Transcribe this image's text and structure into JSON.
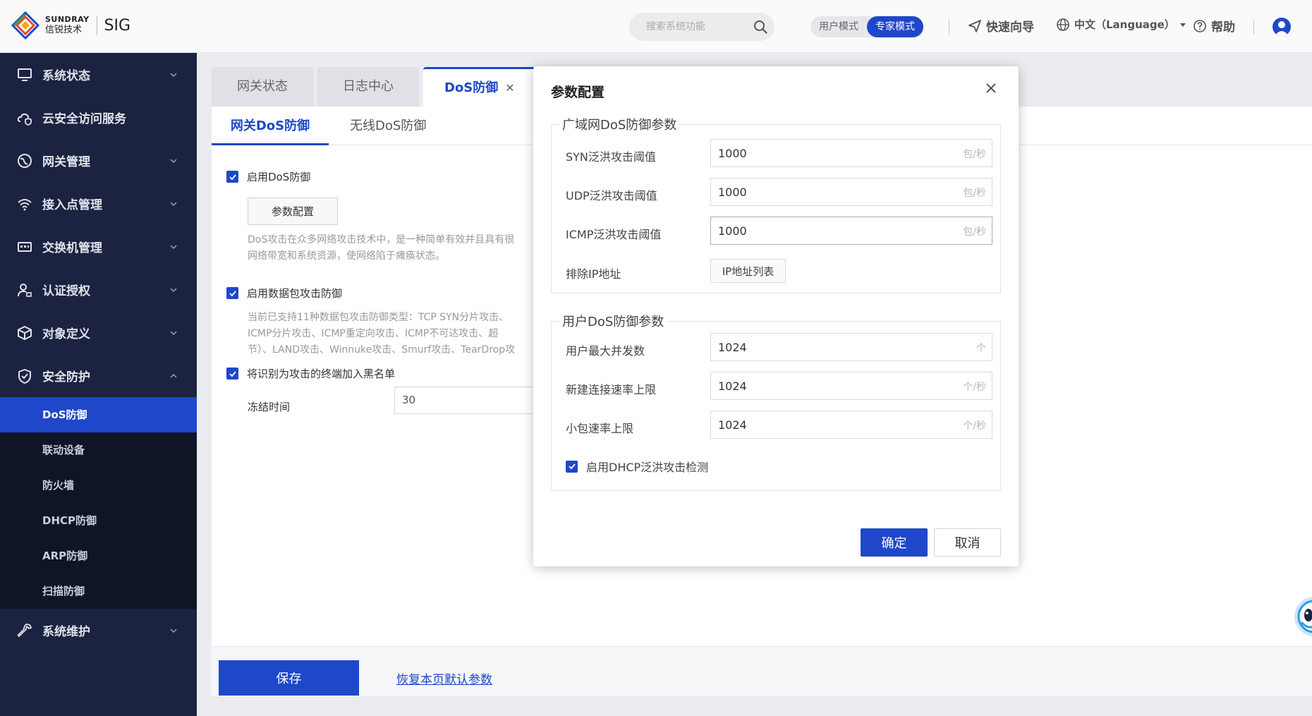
{
  "header": {
    "logo_en": "SUNDRAY",
    "logo_cn": "信锐技术",
    "product": "SIG",
    "search_placeholder": "搜索系统功能",
    "mode_user": "用户模式",
    "mode_expert": "专家模式",
    "quick_guide": "快速向导",
    "language": "中文（Language）",
    "help": "帮助"
  },
  "sidebar": {
    "items": [
      {
        "label": "系统状态"
      },
      {
        "label": "云安全访问服务"
      },
      {
        "label": "网关管理"
      },
      {
        "label": "接入点管理"
      },
      {
        "label": "交换机管理"
      },
      {
        "label": "认证授权"
      },
      {
        "label": "对象定义"
      },
      {
        "label": "安全防护"
      },
      {
        "label": "系统维护"
      }
    ],
    "security_sub": [
      {
        "label": "DoS防御"
      },
      {
        "label": "联动设备"
      },
      {
        "label": "防火墙"
      },
      {
        "label": "DHCP防御"
      },
      {
        "label": "ARP防御"
      },
      {
        "label": "扫描防御"
      }
    ]
  },
  "tabs": [
    {
      "label": "网关状态"
    },
    {
      "label": "日志中心"
    },
    {
      "label": "DoS防御"
    }
  ],
  "subtabs": [
    {
      "label": "网关DoS防御"
    },
    {
      "label": "无线DoS防御"
    }
  ],
  "page": {
    "enable_dos": "启用DoS防御",
    "param_btn": "参数配置",
    "dos_desc_1": "DoS攻击在众多网络攻击技术中，是一种简单有效并且具有很",
    "dos_desc_2": "网络带宽和系统资源，使网络陷于瘫痪状态。",
    "enable_packet": "启用数据包攻击防御",
    "packet_desc_1": "当前已支持11种数据包攻击防御类型：TCP SYN分片攻击、",
    "packet_desc_2": "ICMP分片攻击、ICMP重定向攻击、ICMP不可达攻击、超",
    "packet_desc_3": "节）、LAND攻击、Winnuke攻击、Smurf攻击、TearDrop攻",
    "blacklist": "将识别为攻击的终端加入黑名单",
    "freeze_label": "冻结时间",
    "freeze_value": "30",
    "save": "保存",
    "restore": "恢复本页默认参数"
  },
  "modal": {
    "title": "参数配置",
    "wan_group": "广域网DoS防御参数",
    "syn_label": "SYN泛洪攻击阈值",
    "syn_value": "1000",
    "udp_label": "UDP泛洪攻击阈值",
    "udp_value": "1000",
    "icmp_label": "ICMP泛洪攻击阈值",
    "icmp_value": "1000",
    "pps_unit": "包/秒",
    "exclude_label": "排除IP地址",
    "ip_list_btn": "IP地址列表",
    "user_group": "用户DoS防御参数",
    "max_conc_label": "用户最大并发数",
    "max_conc_value": "1024",
    "max_conc_unit": "个",
    "new_conn_label": "新建连接速率上限",
    "new_conn_value": "1024",
    "rate_unit": "个/秒",
    "small_pkt_label": "小包速率上限",
    "small_pkt_value": "1024",
    "dhcp_flood": "启用DHCP泛洪攻击检测",
    "ok": "确定",
    "cancel": "取消"
  },
  "colors": {
    "brand": "#1f47c9",
    "sidebar": "#1b2340",
    "submenu": "#0f1527"
  }
}
